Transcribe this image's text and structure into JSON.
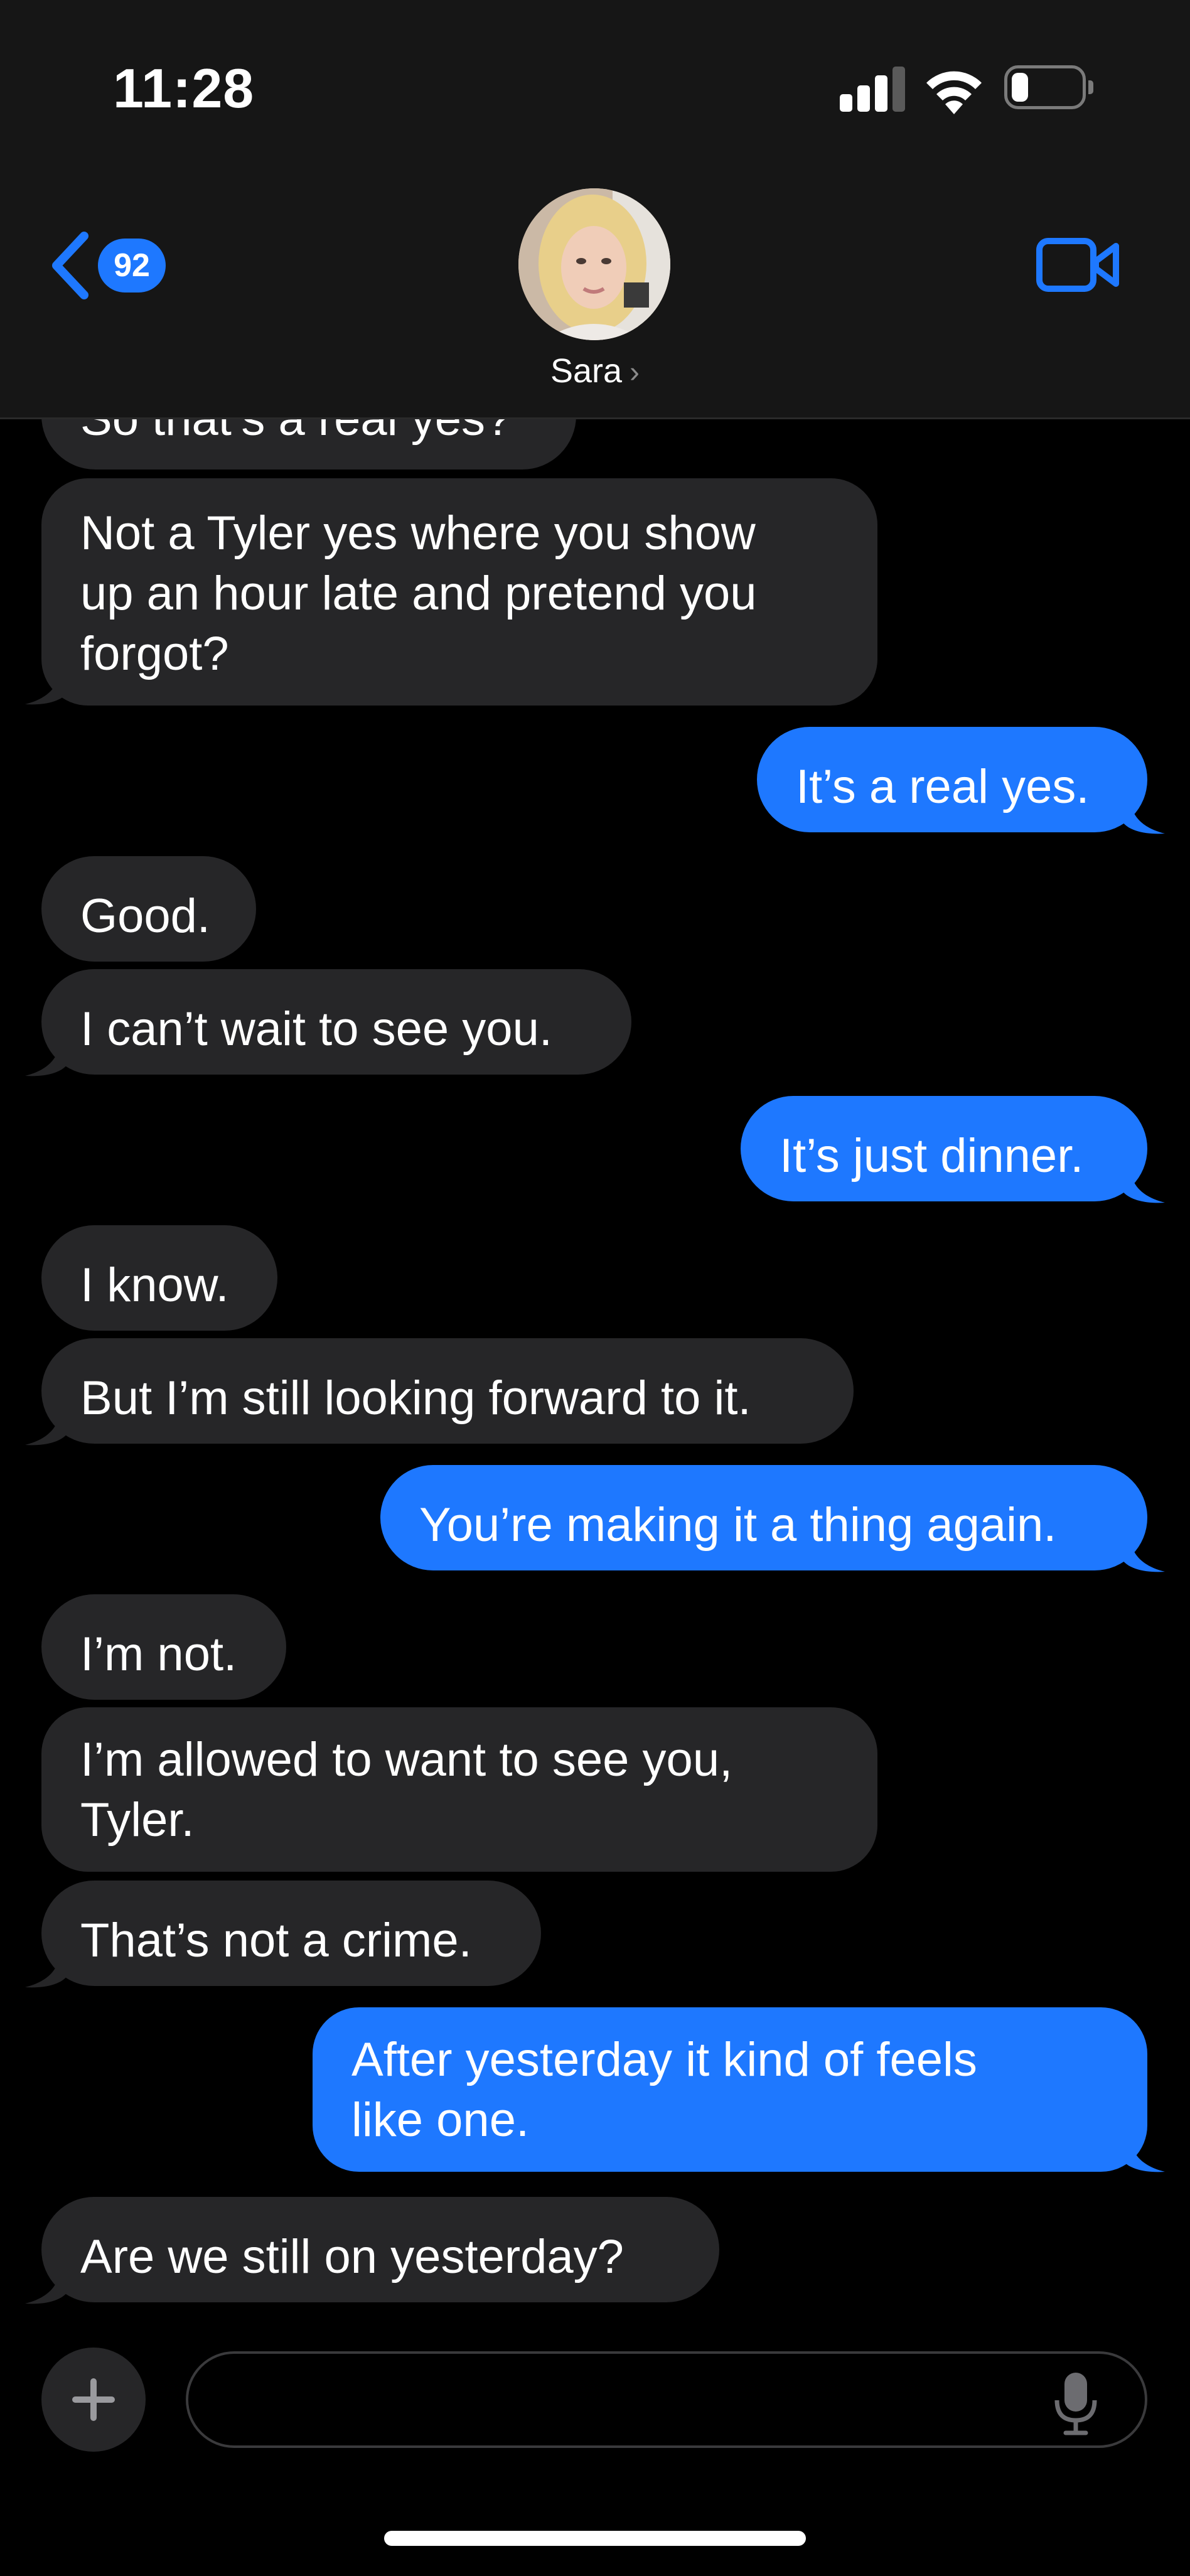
{
  "status_bar": {
    "time": "11:28"
  },
  "header": {
    "back_count": "92",
    "contact_name": "Sara",
    "contact_chevron": "›",
    "video_icon": "video-camera-icon"
  },
  "messages": [
    {
      "sender": "contact",
      "text": "So that’s a real yes?"
    },
    {
      "sender": "contact",
      "text": [
        "Not a Tyler yes where you show",
        "up an hour late and pretend you",
        "forgot?"
      ]
    },
    {
      "sender": "me",
      "text": "It’s a real yes."
    },
    {
      "sender": "contact",
      "text": "Good."
    },
    {
      "sender": "contact",
      "text": "I can’t wait to see you."
    },
    {
      "sender": "me",
      "text": "It’s just dinner."
    },
    {
      "sender": "contact",
      "text": "I know."
    },
    {
      "sender": "contact",
      "text": "But I’m still looking forward to it."
    },
    {
      "sender": "me",
      "text": "You’re making it a thing again."
    },
    {
      "sender": "contact",
      "text": "I’m not."
    },
    {
      "sender": "contact",
      "text": [
        "I’m allowed to want to see you,",
        "Tyler."
      ]
    },
    {
      "sender": "contact",
      "text": "That’s not a crime."
    },
    {
      "sender": "me",
      "text": [
        "After yesterday it kind of feels",
        "like one."
      ]
    },
    {
      "sender": "contact",
      "text": "Are we still on yesterday?"
    }
  ],
  "composer": {
    "plus_icon": "plus-icon",
    "mic_icon": "microphone-icon"
  },
  "colors": {
    "outgoing": "#1e78ff",
    "incoming": "#262628",
    "background": "#000000",
    "header": "#161616"
  }
}
